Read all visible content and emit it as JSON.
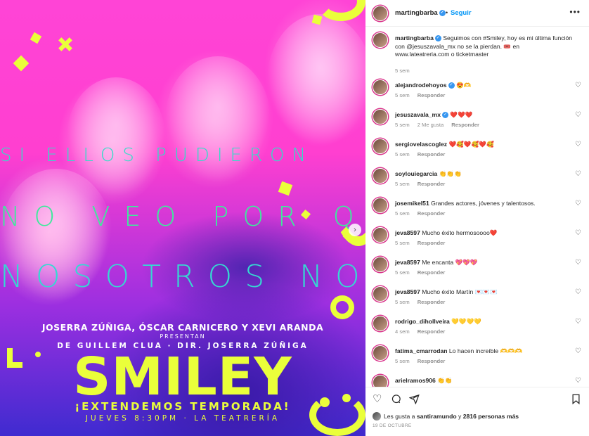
{
  "poster": {
    "line1": "SI ELLOS PUDIERON",
    "line2": "NO VEO POR QUÉ",
    "line3": "NOSOTROS NO",
    "presenters": "JOSERRA ZÚÑIGA, ÓSCAR CARNICERO Y XEVI ARANDA",
    "presentan": "PRESENTAN",
    "authors": "DE GUILLEM CLUA · DIR. JOSERRA ZÚÑIGA",
    "title": "SMILEY",
    "extend": "¡EXTENDEMOS TEMPORADA!",
    "schedule": "JUEVES 8:30PM · LA TEATRERÍA",
    "colors": {
      "pink": "#ff3fd0",
      "blue": "#3f2bd0",
      "yellow": "#eaff3a",
      "teal": "#2fe0c8"
    }
  },
  "header": {
    "owner": "martingbarba",
    "dot": "•",
    "follow": "Seguir",
    "more_icon": "more-horizontal-icon"
  },
  "caption": {
    "user": "martingbarba",
    "text": "Seguimos con #Smiley, hoy es mi última función con @jesuszavala_mx no se la pierdan. 🎟️ en www.lateatreria.com o ticketmaster",
    "time": "5 sem"
  },
  "comments": [
    {
      "user": "alejandrodehoyos",
      "verified": true,
      "text": "😍🫶",
      "time": "5 sem",
      "likes": "",
      "reply": "Responder"
    },
    {
      "user": "jesuszavala_mx",
      "verified": true,
      "text": "❤️❤️❤️",
      "time": "5 sem",
      "likes": "2 Me gusta",
      "reply": "Responder"
    },
    {
      "user": "sergiovelascoglez",
      "verified": false,
      "text": "❤️🥰❤️🥰❤️🥰",
      "time": "5 sem",
      "likes": "",
      "reply": "Responder"
    },
    {
      "user": "soylouiegarcia",
      "verified": false,
      "text": "👏👏👏",
      "time": "5 sem",
      "likes": "",
      "reply": "Responder"
    },
    {
      "user": "josemikel51",
      "verified": false,
      "text": "Grandes actores, jóvenes y talentosos.",
      "time": "5 sem",
      "likes": "",
      "reply": "Responder"
    },
    {
      "user": "jeva8597",
      "verified": false,
      "text": "Mucho éxito hermosoooo❤️",
      "time": "5 sem",
      "likes": "",
      "reply": "Responder"
    },
    {
      "user": "jeva8597",
      "verified": false,
      "text": "Me encanta 💖💖💖",
      "time": "5 sem",
      "likes": "",
      "reply": "Responder"
    },
    {
      "user": "jeva8597",
      "verified": false,
      "text": "Mucho éxito Martín 💌💌💌",
      "time": "5 sem",
      "likes": "",
      "reply": "Responder"
    },
    {
      "user": "rodrigo_dihollveira",
      "verified": false,
      "text": "💛💛💛💛",
      "time": "4 sem",
      "likes": "",
      "reply": "Responder"
    },
    {
      "user": "fatima_cmarrodan",
      "verified": false,
      "text": "Lo hacen increíble 🫶🫶🫶",
      "time": "5 sem",
      "likes": "",
      "reply": "Responder"
    },
    {
      "user": "arielramos906",
      "verified": false,
      "text": "👏👏",
      "time": "",
      "likes": "",
      "reply": ""
    }
  ],
  "actions": {
    "like_icon": "heart-icon",
    "comment_icon": "comment-icon",
    "share_icon": "share-icon",
    "save_icon": "bookmark-icon"
  },
  "likes": {
    "prefix": "Les gusta a",
    "user": "santiramundo",
    "middle": "y",
    "count": "2816 personas más"
  },
  "date": "19 DE OCTUBRE"
}
